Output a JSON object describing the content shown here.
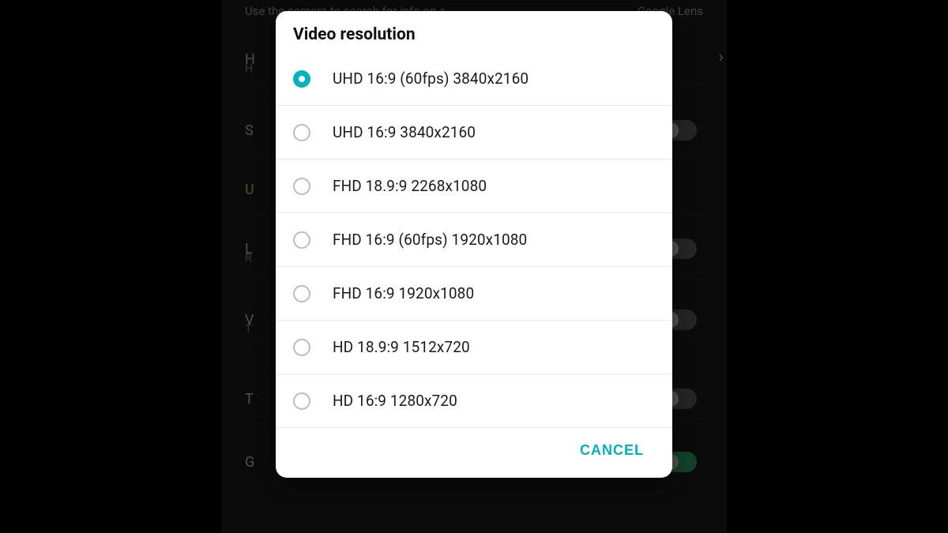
{
  "colors": {
    "accent": "#00b2bd",
    "text": "#1a1a1a",
    "divider": "#e9e9e9",
    "radio_off": "#bdbdbd"
  },
  "backdrop": {
    "top_hint_left": "Use the camera to search for info on a",
    "top_hint_right": "Google Lens",
    "row_h": "H",
    "row_h_sub": "H",
    "row_s": "S",
    "row_u": "U",
    "row_l": "L",
    "row_l_sub": "R",
    "row_v": "V",
    "row_v_sub": "T",
    "row_t": "T",
    "row_g": "G"
  },
  "dialog": {
    "title": "Video resolution",
    "selected_index": 0,
    "options": [
      {
        "label": "UHD 16:9 (60fps) 3840x2160"
      },
      {
        "label": "UHD 16:9 3840x2160"
      },
      {
        "label": "FHD 18.9:9 2268x1080"
      },
      {
        "label": "FHD 16:9 (60fps) 1920x1080"
      },
      {
        "label": "FHD 16:9 1920x1080"
      },
      {
        "label": "HD 18.9:9 1512x720"
      },
      {
        "label": "HD 16:9 1280x720"
      }
    ],
    "cancel_label": "CANCEL"
  }
}
